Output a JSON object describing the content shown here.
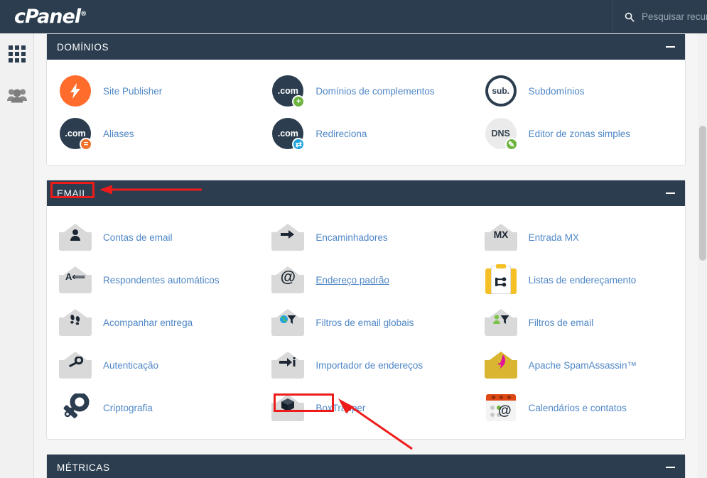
{
  "topbar": {
    "logo_text": "cPanel",
    "logo_mark": "®",
    "search_icon": "search-icon",
    "search_placeholder": "Pesquisar recurs",
    "search_value": ""
  },
  "sidebar": {
    "items": [
      {
        "name": "apps-grid",
        "icon": "grid-icon",
        "active": true
      },
      {
        "name": "user-manager",
        "icon": "people-icon",
        "active": false
      }
    ]
  },
  "colors": {
    "header_bg": "#2b3d4f",
    "link": "#4f87c6",
    "accent_orange": "#ff6c2c",
    "accent_green": "#6cb33f",
    "accent_blue": "#1fa2de",
    "annotation_red": "#ee1b1b",
    "gold": "#d9b531",
    "yellow": "#f5c026",
    "calendar_red": "#dd4814"
  },
  "sections": [
    {
      "id": "dominios",
      "title": "DOMÍNIOS",
      "collapse_label": "−",
      "items": [
        {
          "label": "Site Publisher",
          "icon": "site-publisher-icon"
        },
        {
          "label": "Domínios de complementos",
          "icon": "addon-domains-icon"
        },
        {
          "label": "Subdomínios",
          "icon": "subdomains-icon"
        },
        {
          "label": "Aliases",
          "icon": "aliases-icon"
        },
        {
          "label": "Redireciona",
          "icon": "redirects-icon"
        },
        {
          "label": "Editor de zonas simples",
          "icon": "simple-zone-editor-icon"
        }
      ]
    },
    {
      "id": "email",
      "title": "EMAIL",
      "collapse_label": "−",
      "items": [
        {
          "label": "Contas de email",
          "icon": "email-accounts-icon",
          "symbol": "♟"
        },
        {
          "label": "Encaminhadores",
          "icon": "forwarders-icon",
          "symbol": "→"
        },
        {
          "label": "Entrada MX",
          "icon": "mx-entry-icon",
          "symbol": "MX"
        },
        {
          "label": "Respondentes automáticos",
          "icon": "autoresponders-icon",
          "symbol": "A←"
        },
        {
          "label": "Endereço padrão",
          "icon": "default-address-icon",
          "symbol": "@",
          "hovered": true
        },
        {
          "label": "Listas de endereçamento",
          "icon": "mailing-lists-icon",
          "symbol": "↱"
        },
        {
          "label": "Acompanhar entrega",
          "icon": "track-delivery-icon",
          "symbol": "❗"
        },
        {
          "label": "Filtros de email globais",
          "icon": "global-email-filters-icon",
          "symbol": "▼"
        },
        {
          "label": "Filtros de email",
          "icon": "email-filters-icon",
          "symbol": "▼"
        },
        {
          "label": "Autenticação",
          "icon": "authentication-icon",
          "symbol": "⚷"
        },
        {
          "label": "Importador de endereços",
          "icon": "address-importer-icon",
          "symbol": "→i"
        },
        {
          "label": "Apache SpamAssassin™",
          "icon": "spamassassin-icon",
          "symbol": "✐"
        },
        {
          "label": "Criptografia",
          "icon": "encryption-icon",
          "symbol": "⚷"
        },
        {
          "label": "BoxTrapper",
          "icon": "boxtrapper-icon",
          "symbol": "⬛",
          "annotated": true
        },
        {
          "label": "Calendários e contatos",
          "icon": "calendars-contacts-icon",
          "symbol": "@"
        }
      ]
    },
    {
      "id": "metricas",
      "title": "MÉTRICAS",
      "collapse_label": "−",
      "items": []
    }
  ],
  "annotations": [
    {
      "name": "email-highlight-box",
      "type": "rect",
      "target": "EMAIL"
    },
    {
      "name": "email-pointer-arrow",
      "type": "arrow",
      "target": "EMAIL"
    },
    {
      "name": "boxtrapper-highlight-box",
      "type": "rect",
      "target": "BoxTrapper"
    },
    {
      "name": "boxtrapper-pointer-arrow",
      "type": "arrow",
      "target": "BoxTrapper"
    }
  ]
}
